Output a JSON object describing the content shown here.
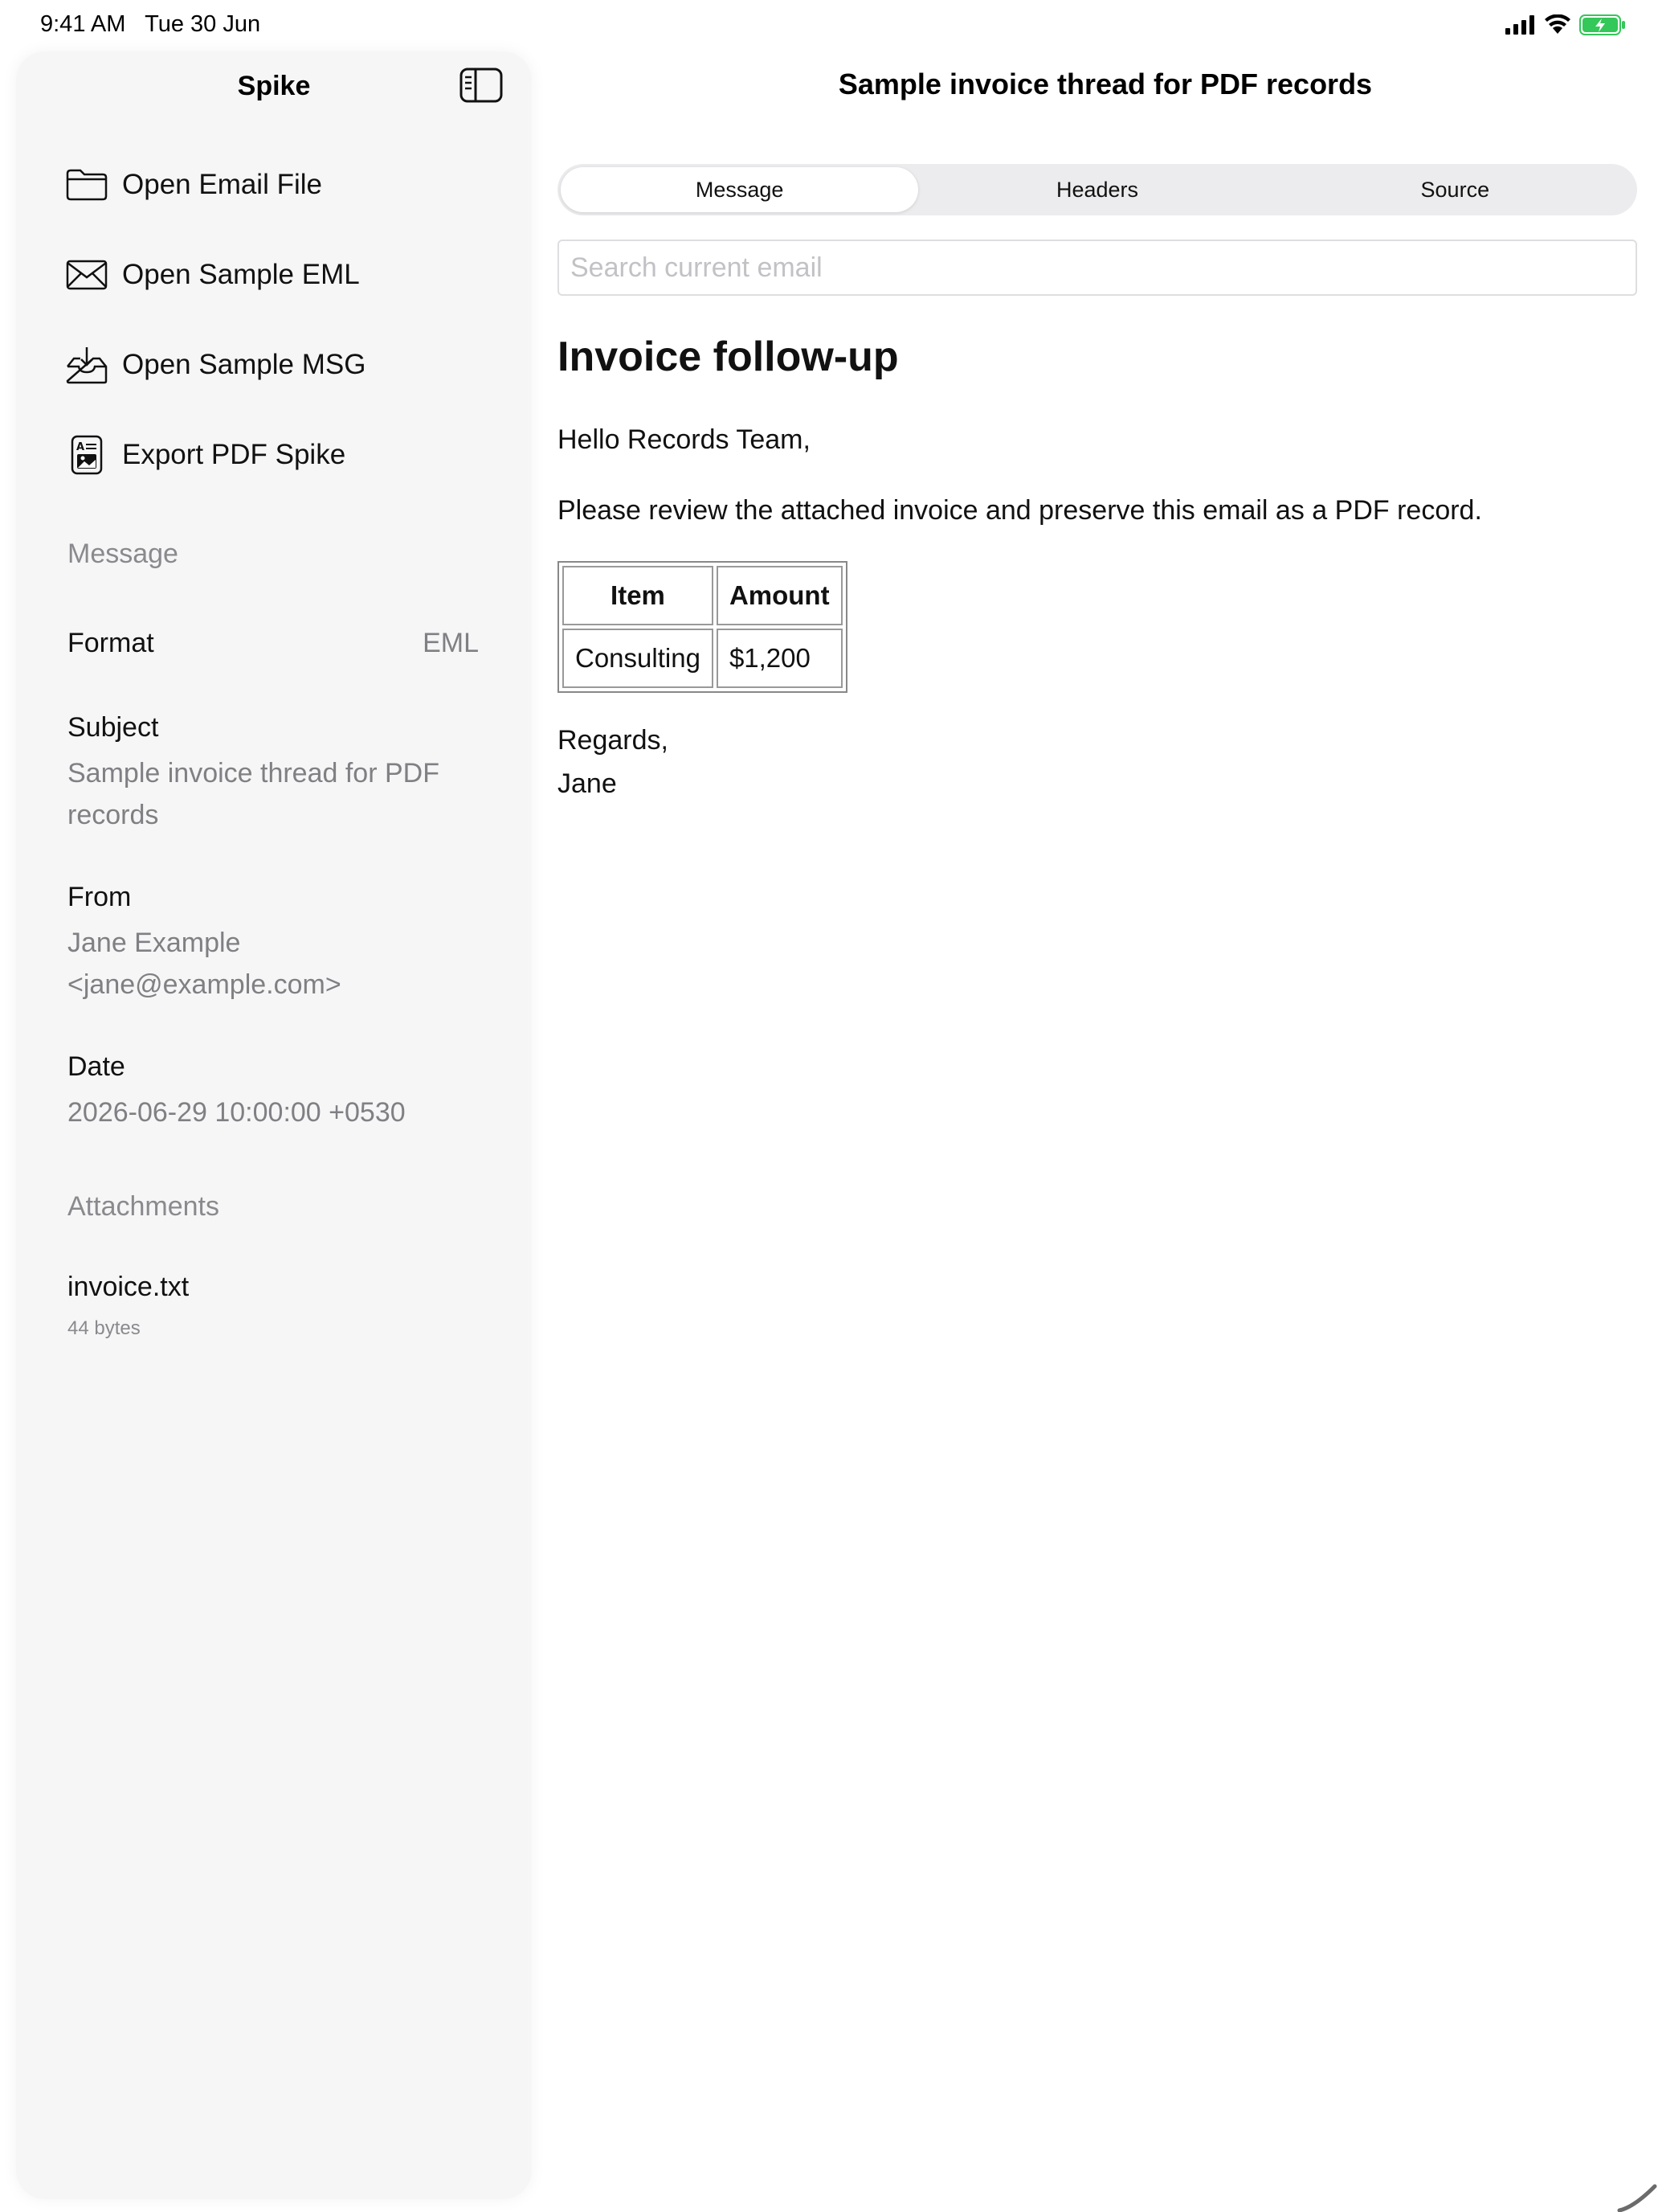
{
  "status_bar": {
    "time": "9:41 AM",
    "date": "Tue 30 Jun",
    "battery_color": "#34c759"
  },
  "sidebar": {
    "title": "Spike",
    "menu": [
      {
        "label": "Open Email File",
        "icon": "folder-icon"
      },
      {
        "label": "Open Sample EML",
        "icon": "envelope-icon"
      },
      {
        "label": "Open Sample MSG",
        "icon": "tray-download-icon"
      },
      {
        "label": "Export PDF Spike",
        "icon": "document-image-icon"
      }
    ],
    "message_section": "Message",
    "format": {
      "label": "Format",
      "value": "EML"
    },
    "subject": {
      "label": "Subject",
      "value": "Sample invoice thread for PDF records"
    },
    "from": {
      "label": "From",
      "value": "Jane Example <jane@example.com>"
    },
    "date": {
      "label": "Date",
      "value": "2026-06-29 10:00:00 +0530"
    },
    "attachments_section": "Attachments",
    "attachments": [
      {
        "name": "invoice.txt",
        "size": "44 bytes"
      }
    ]
  },
  "main": {
    "title": "Sample invoice thread for PDF records",
    "tabs": [
      {
        "label": "Message",
        "active": true
      },
      {
        "label": "Headers",
        "active": false
      },
      {
        "label": "Source",
        "active": false
      }
    ],
    "search": {
      "placeholder": "Search current email",
      "value": ""
    },
    "email": {
      "heading": "Invoice follow-up",
      "greeting": "Hello Records Team,",
      "body": "Please review the attached invoice and preserve this email as a PDF record.",
      "table": {
        "headers": [
          "Item",
          "Amount"
        ],
        "rows": [
          [
            "Consulting",
            "$1,200"
          ]
        ]
      },
      "closing": "Regards,",
      "signature": "Jane"
    }
  }
}
